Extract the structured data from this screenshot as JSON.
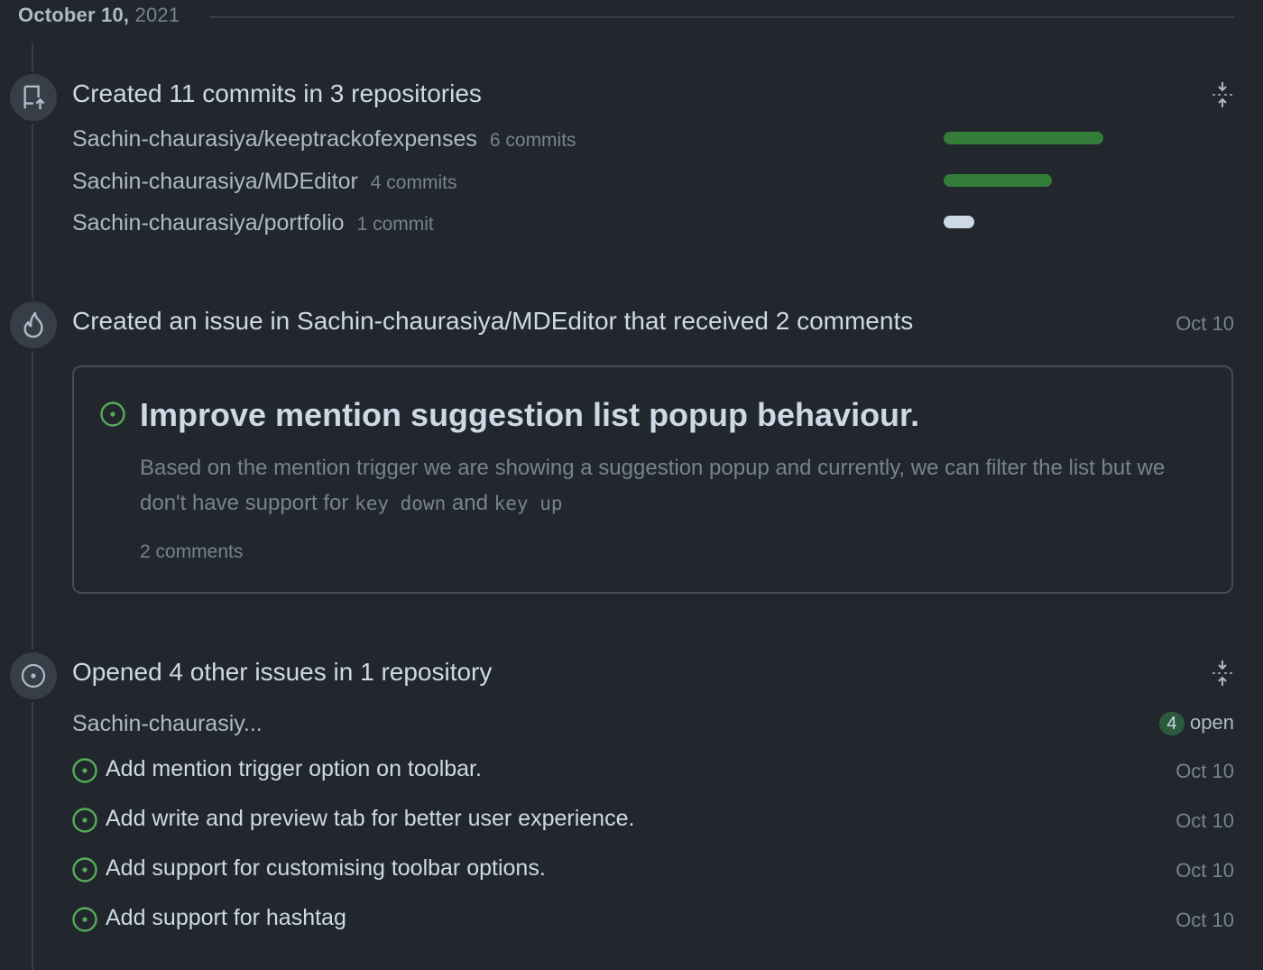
{
  "date_header": {
    "month_day": "October 10,",
    "year": "2021"
  },
  "commits": {
    "title": "Created 11 commits in 3 repositories",
    "repos": [
      {
        "name": "Sachin-chaurasiya/keeptrackofexpenses",
        "count": "6 commits",
        "bar_fraction": 1.0,
        "bar_color": "#347d39"
      },
      {
        "name": "Sachin-chaurasiya/MDEditor",
        "count": "4 commits",
        "bar_fraction": 0.68,
        "bar_color": "#347d39"
      },
      {
        "name": "Sachin-chaurasiya/portfolio",
        "count": "1 commit",
        "bar_fraction": 0.19,
        "bar_color": "#cdd9e5"
      }
    ]
  },
  "created_issue": {
    "title": "Created an issue in Sachin-chaurasiya/MDEditor that received 2 comments",
    "date": "Oct 10",
    "issue": {
      "title": "Improve mention suggestion list popup behaviour.",
      "body_text": "Based on the mention trigger we are showing a suggestion popup and currently, we can filter the list but we don't have support for",
      "code_1": "key down",
      "and_text": "and",
      "code_2": "key up",
      "comments": "2 comments"
    }
  },
  "opened_issues": {
    "title": "Opened 4 other issues in 1 repository",
    "repo": "Sachin-chaurasiy...",
    "open_count": "4",
    "open_label": "open",
    "items": [
      {
        "title": "Add mention trigger option on toolbar.",
        "date": "Oct 10"
      },
      {
        "title": "Add write and preview tab for better user experience.",
        "date": "Oct 10"
      },
      {
        "title": "Add support for customising toolbar options.",
        "date": "Oct 10"
      },
      {
        "title": "Add support for hashtag",
        "date": "Oct 10"
      }
    ]
  },
  "colors": {
    "background": "#22272e",
    "accent_green": "#57ab5a",
    "bar_green": "#347d39",
    "muted": "#768390"
  }
}
